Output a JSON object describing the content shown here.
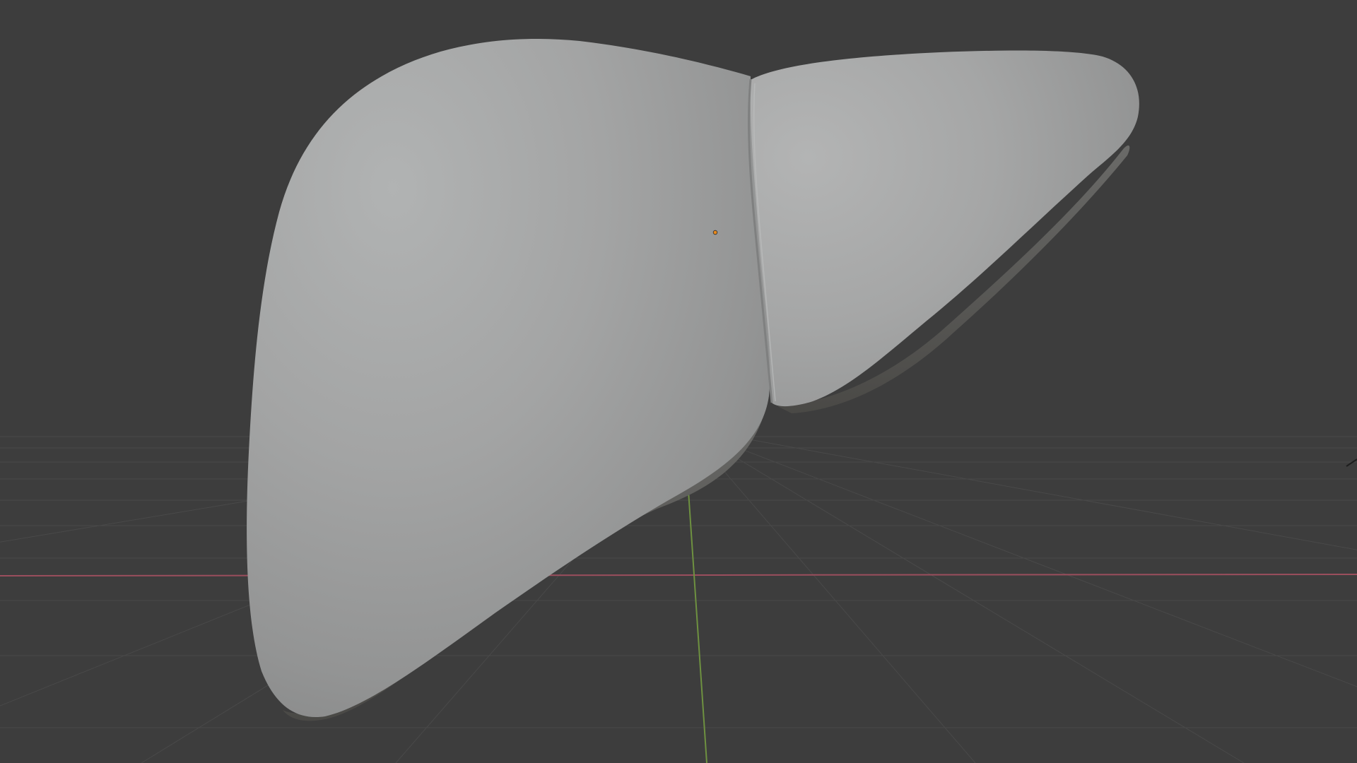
{
  "viewport": {
    "background_color": "#3d3d3d",
    "grid_color": "#4a4a4a",
    "x_axis_color": "#9b4e5d",
    "y_axis_color": "#6e9140",
    "origin_color": "#e8891c",
    "object_shading_color": "#a8a9aa",
    "navigation_gizmo_icon": "axis-gizmo-icon",
    "origin_icon": "object-origin-icon"
  }
}
